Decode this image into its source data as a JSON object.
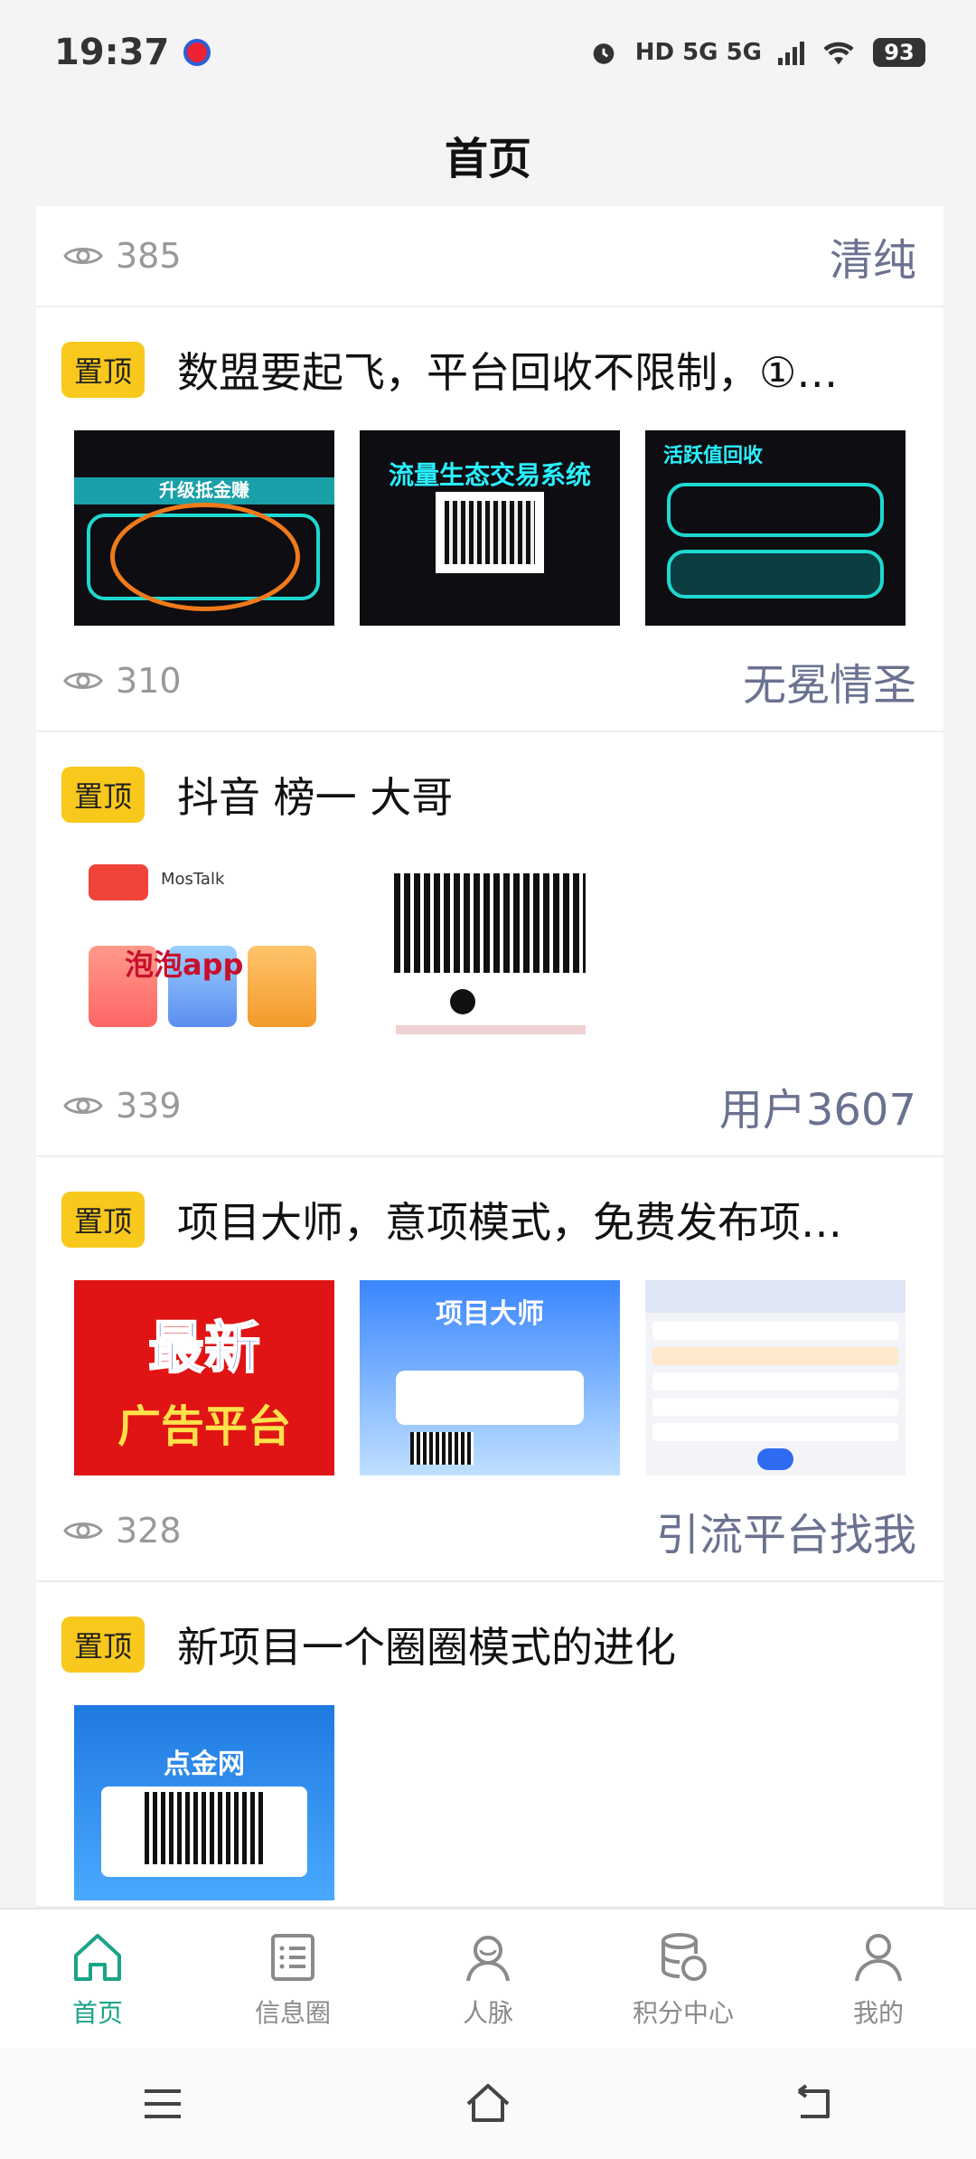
{
  "status_bar": {
    "time": "19:37",
    "network": "HD 5G 5G",
    "battery": "93"
  },
  "header": {
    "title": "首页"
  },
  "posts": [
    {
      "views": "385",
      "author": "清纯"
    },
    {
      "pin": "置顶",
      "title": "数盟要起飞，平台回收不限制，①…",
      "views": "310",
      "author": "无冕情圣",
      "thumb_texts": {
        "a": "升级抵金赚",
        "b": "流量生态交易系统",
        "c": "活跃值回收"
      }
    },
    {
      "pin": "置顶",
      "title": "抖音 榜一 大哥",
      "views": "339",
      "author": "用户3607",
      "thumb_texts": {
        "a": "泡泡app",
        "b": "MosTalk"
      }
    },
    {
      "pin": "置顶",
      "title": "项目大师，意项模式，免费发布项…",
      "views": "328",
      "author": "引流平台找我",
      "thumb_texts": {
        "a_big": "最新",
        "a_small": "广告平台",
        "b": "项目大师"
      }
    },
    {
      "pin": "置顶",
      "title": "新项目一个圈圈模式的进化",
      "thumb_texts": {
        "a": "点金网"
      }
    }
  ],
  "tabs": [
    {
      "label": "首页",
      "icon": "home-icon",
      "active": true
    },
    {
      "label": "信息圈",
      "icon": "list-icon",
      "active": false
    },
    {
      "label": "人脉",
      "icon": "contacts-icon",
      "active": false
    },
    {
      "label": "积分中心",
      "icon": "database-icon",
      "active": false
    },
    {
      "label": "我的",
      "icon": "user-icon",
      "active": false
    }
  ],
  "colors": {
    "accent": "#1aa387",
    "pin_badge": "#f8c81c",
    "author": "#6b7290"
  }
}
